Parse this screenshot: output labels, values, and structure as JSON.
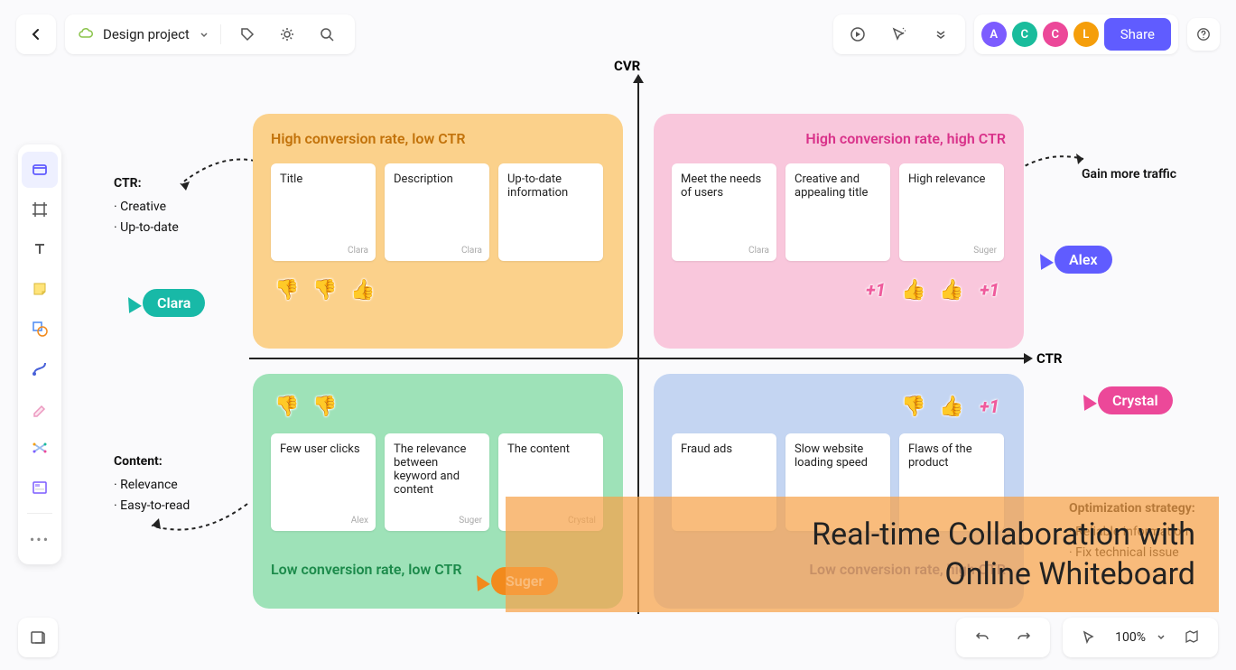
{
  "header": {
    "project_name": "Design project",
    "share_label": "Share",
    "zoom": "100%",
    "avatars": [
      "A",
      "C",
      "C",
      "L"
    ]
  },
  "axes": {
    "y_label": "CVR",
    "x_label": "CTR"
  },
  "annotations": {
    "ctr": {
      "title": "CTR:",
      "items": [
        "Creative",
        "Up-to-date"
      ]
    },
    "content": {
      "title": "Content:",
      "items": [
        "Relevance",
        "Easy-to-read"
      ]
    },
    "gain_traffic": "Gain more traffic",
    "opt_strategy": {
      "title": "Optimization strategy:",
      "items": [
        "Reliable information",
        "Fix technical issue"
      ]
    }
  },
  "quadrants": {
    "tl": {
      "title": "High conversion rate, low CTR",
      "cards": [
        {
          "text": "Title",
          "author": "Clara"
        },
        {
          "text": "Description",
          "author": "Clara"
        },
        {
          "text": "Up-to-date information",
          "author": ""
        }
      ],
      "reactions": [
        "👎",
        "👎",
        "👍"
      ]
    },
    "tr": {
      "title": "High conversion rate, high CTR",
      "cards": [
        {
          "text": "Meet the needs of users",
          "author": "Clara"
        },
        {
          "text": "Creative and appealing title",
          "author": ""
        },
        {
          "text": "High relevance",
          "author": "Suger"
        }
      ],
      "reactions": [
        "+1",
        "👍",
        "👍",
        "+1"
      ]
    },
    "bl": {
      "title": "Low conversion rate, low CTR",
      "cards": [
        {
          "text": "Few user clicks",
          "author": "Alex"
        },
        {
          "text": "The relevance between keyword and content",
          "author": "Suger"
        },
        {
          "text": "The content",
          "author": "Crystal"
        }
      ],
      "reactions": [
        "👎",
        "👎"
      ]
    },
    "br": {
      "title": "Low conversion rate, high CTR",
      "cards": [
        {
          "text": "Fraud ads",
          "author": ""
        },
        {
          "text": "Slow website loading speed",
          "author": ""
        },
        {
          "text": "Flaws of the product",
          "author": ""
        }
      ],
      "reactions": [
        "👎",
        "👍",
        "+1"
      ]
    }
  },
  "cursors": {
    "clara": "Clara",
    "alex": "Alex",
    "crystal": "Crystal",
    "suger": "Suger"
  },
  "overlay": "Real-time Collaboration with\nOnline Whiteboard"
}
